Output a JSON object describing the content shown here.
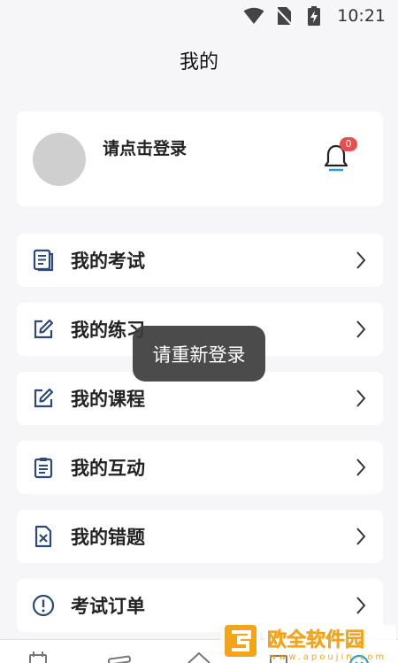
{
  "status_bar": {
    "time": "10:21"
  },
  "header": {
    "title": "我的"
  },
  "profile": {
    "login_prompt": "请点击登录",
    "notification_count": "0"
  },
  "menu": [
    {
      "label": "我的考试",
      "icon": "document-list-icon"
    },
    {
      "label": "我的练习",
      "icon": "edit-icon"
    },
    {
      "label": "我的课程",
      "icon": "edit-icon"
    },
    {
      "label": "我的互动",
      "icon": "clipboard-icon"
    },
    {
      "label": "我的错题",
      "icon": "wrong-answer-icon"
    },
    {
      "label": "考试订单",
      "icon": "alert-circle-icon"
    }
  ],
  "toast": {
    "message": "请重新登录"
  },
  "watermark": {
    "brand_text": "欧全软件园",
    "site_text": "www.apoujin.com"
  },
  "colors": {
    "badge": "#e94d4d",
    "bell_accent": "#2aa0d8",
    "background": "#f6f6f8"
  }
}
